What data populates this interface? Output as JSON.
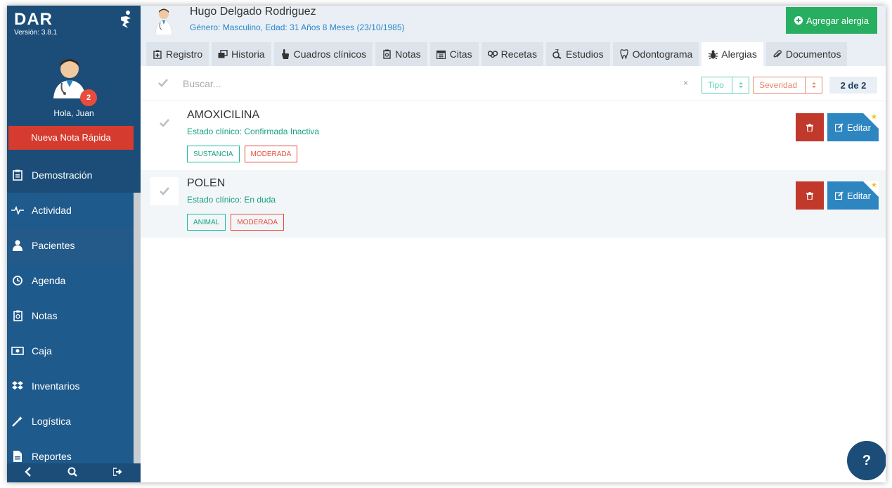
{
  "app": {
    "brand": "DAR",
    "version": "Versión: 3.8.1"
  },
  "profile": {
    "notifications": "2",
    "greeting": "Hola, Juan",
    "quick_note": "Nueva Nota Rápida"
  },
  "sidebar": {
    "items": [
      {
        "label": "Demostración",
        "icon": "clipboard-icon"
      },
      {
        "label": "Actividad",
        "icon": "pulse-icon"
      },
      {
        "label": "Pacientes",
        "icon": "patient-icon"
      },
      {
        "label": "Agenda",
        "icon": "clock-icon"
      },
      {
        "label": "Notas",
        "icon": "notes-icon"
      },
      {
        "label": "Caja",
        "icon": "money-icon"
      },
      {
        "label": "Inventarios",
        "icon": "dropbox-icon"
      },
      {
        "label": "Logística",
        "icon": "wand-icon"
      },
      {
        "label": "Reportes",
        "icon": "file-icon"
      }
    ],
    "active_index": 2
  },
  "patient": {
    "name": "Hugo Delgado Rodriguez",
    "info": "Género: Masculino, Edad: 31 Años 8 Meses (23/10/1985)"
  },
  "header": {
    "add_button": "Agregar alergia"
  },
  "tabs": [
    {
      "label": "Registro",
      "icon": "medical-icon"
    },
    {
      "label": "Historia",
      "icon": "history-icon"
    },
    {
      "label": "Cuadros clínicos",
      "icon": "hand-icon"
    },
    {
      "label": "Notas",
      "icon": "notes-icon"
    },
    {
      "label": "Citas",
      "icon": "calendar-icon"
    },
    {
      "label": "Recetas",
      "icon": "pills-icon"
    },
    {
      "label": "Estudios",
      "icon": "flask-icon"
    },
    {
      "label": "Odontograma",
      "icon": "tooth-icon"
    },
    {
      "label": "Alergias",
      "icon": "bug-icon"
    },
    {
      "label": "Documentos",
      "icon": "paperclip-icon"
    }
  ],
  "active_tab_index": 8,
  "search": {
    "placeholder": "Buscar...",
    "clear": "×",
    "type_filter": "Tipo",
    "severity_filter": "Severidad",
    "count": "2 de 2"
  },
  "allergies": [
    {
      "name": "AMOXICILINA",
      "status": "Estado clínico: Confirmada Inactiva",
      "type": "SUSTANCIA",
      "severity": "MODERADA",
      "edit_label": "Editar"
    },
    {
      "name": "POLEN",
      "status": "Estado clínico: En duda",
      "type": "ANIMAL",
      "severity": "MODERADA",
      "edit_label": "Editar"
    }
  ],
  "help": "?",
  "colors": {
    "sidebar": "#1b4d78",
    "accent_green": "#27ae60",
    "danger": "#c0392b",
    "primary": "#2e86c1"
  }
}
